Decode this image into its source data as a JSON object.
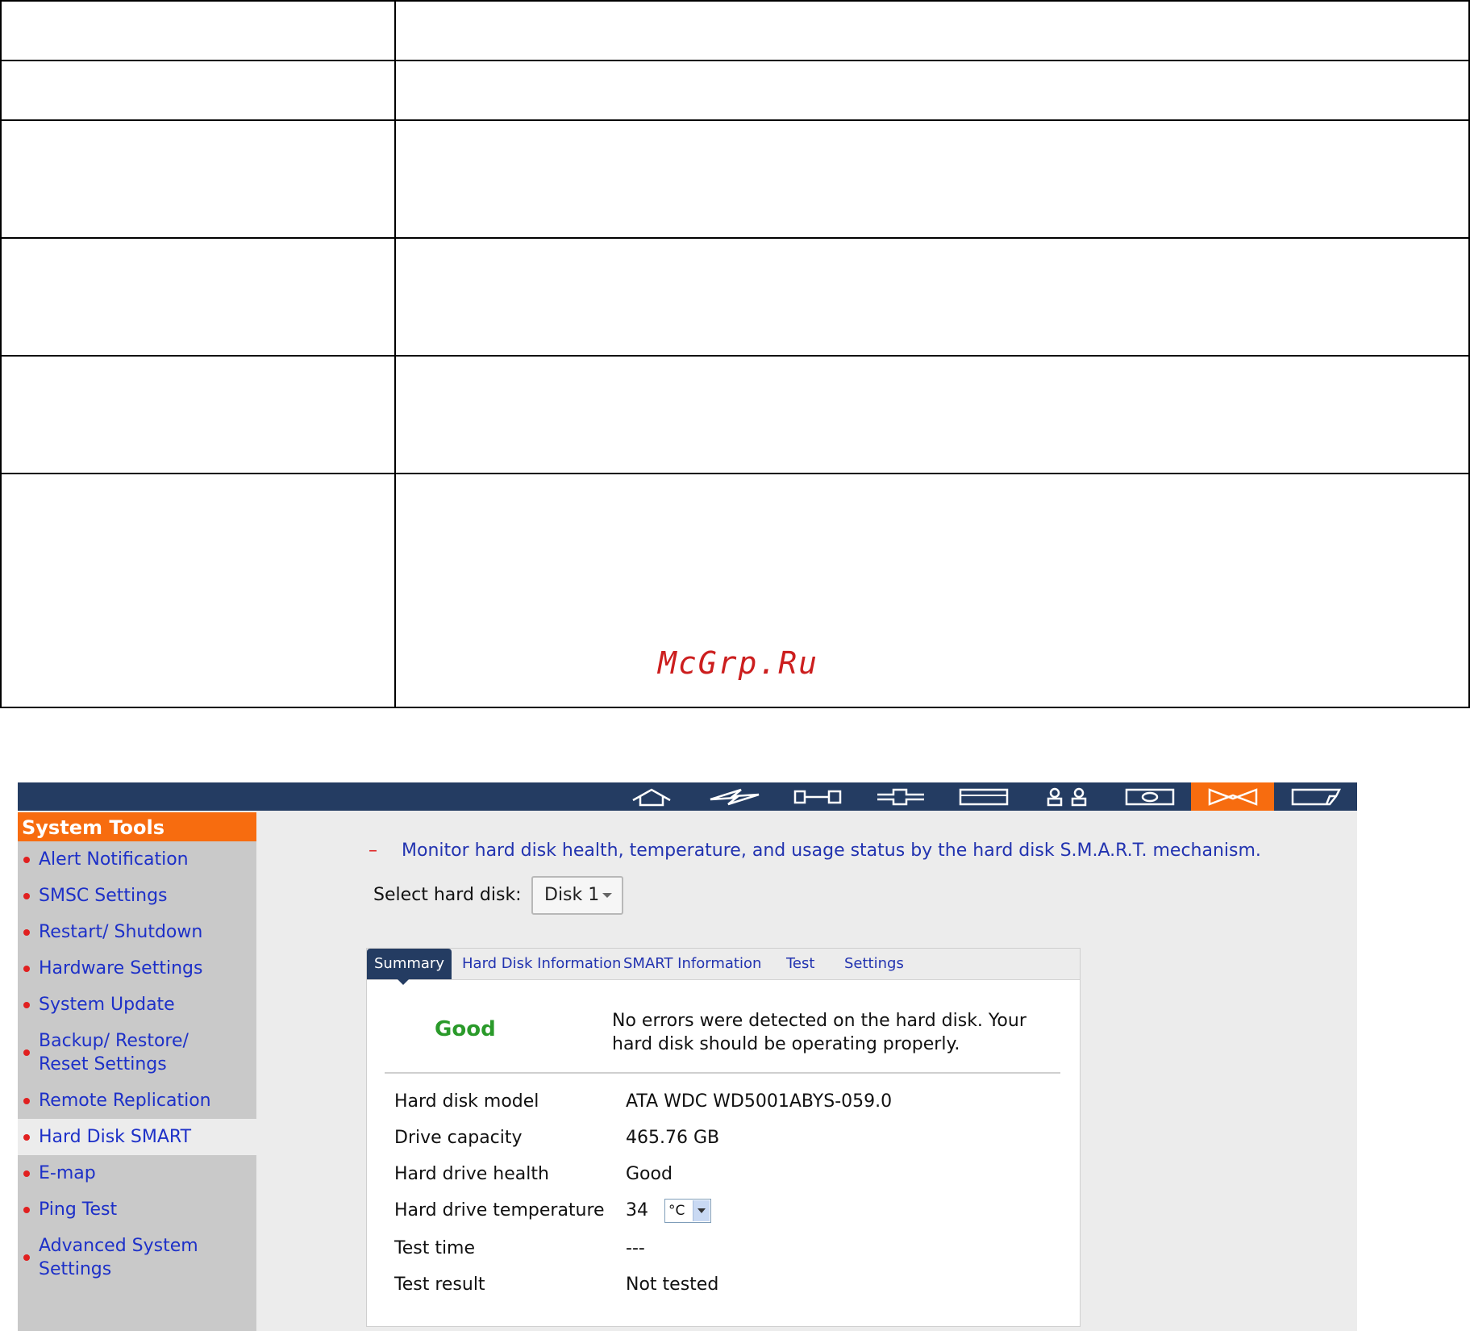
{
  "watermark": "McGrp.Ru",
  "topbar": {
    "icons": [
      "home-icon",
      "lightning-icon",
      "tools-icon",
      "network-icon",
      "disk-icon",
      "users-icon",
      "camera-icon",
      "system-tools-icon",
      "log-icon"
    ]
  },
  "sidebar": {
    "title": "System Tools",
    "items": [
      {
        "label": "Alert Notification"
      },
      {
        "label": "SMSC Settings"
      },
      {
        "label": "Restart/ Shutdown"
      },
      {
        "label": "Hardware Settings"
      },
      {
        "label": "System Update"
      },
      {
        "label": "Backup/ Restore/ Reset Settings"
      },
      {
        "label": "Remote Replication"
      },
      {
        "label": "Hard Disk SMART"
      },
      {
        "label": "E-map"
      },
      {
        "label": "Ping Test"
      },
      {
        "label": "Advanced System Settings"
      }
    ]
  },
  "main": {
    "description": "Monitor hard disk health, temperature, and usage status by the hard disk S.M.A.R.T. mechanism.",
    "select_label": "Select hard disk:",
    "select_value": "Disk 1",
    "tabs": [
      "Summary",
      "Hard Disk Information",
      "SMART Information",
      "Test",
      "Settings"
    ],
    "status": "Good",
    "status_message": "No errors were detected on the hard disk. Your hard disk should be operating properly.",
    "details": [
      {
        "label": "Hard disk model",
        "value": "ATA WDC WD5001ABYS-059.0"
      },
      {
        "label": "Drive capacity",
        "value": "465.76 GB"
      },
      {
        "label": "Hard drive health",
        "value": "Good"
      },
      {
        "label": "Hard drive temperature",
        "value": "34"
      },
      {
        "label": "Test time",
        "value": "---"
      },
      {
        "label": "Test result",
        "value": "Not tested"
      }
    ],
    "temperature_unit": "°C"
  }
}
